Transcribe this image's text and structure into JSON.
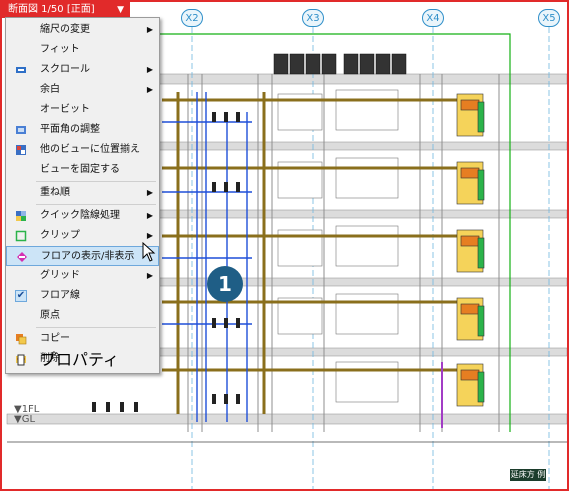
{
  "view_tab": {
    "label": "断面図 1/50 [正面]",
    "dropdown_icon": "triangle-down"
  },
  "grid_labels": [
    "X2",
    "X3",
    "X4",
    "X5"
  ],
  "levels": [
    "▼1FL",
    "▼GL"
  ],
  "scale_box": "延床方 例",
  "context_menu": {
    "items": [
      {
        "label": "縮尺の変更",
        "submenu": true
      },
      {
        "label": "フィット"
      },
      {
        "label": "スクロール",
        "submenu": true,
        "icon": "scroll-icon"
      },
      {
        "label": "余白",
        "submenu": true
      },
      {
        "label": "オービット"
      },
      {
        "label": "平面角の調整",
        "icon": "plane-angle-icon"
      },
      {
        "label": "他のビューに位置揃え",
        "icon": "align-view-icon"
      },
      {
        "label": "ビューを固定する"
      },
      {
        "label": "重ね順",
        "submenu": true
      },
      {
        "label": "クイック陰線処理",
        "submenu": true,
        "icon": "hidden-line-icon"
      },
      {
        "label": "クリップ",
        "submenu": true,
        "icon": "clip-icon"
      },
      {
        "label": "フロアの表示/非表示",
        "highlighted": true,
        "icon": "floor-visibility-icon"
      },
      {
        "label": "グリッド",
        "submenu": true
      },
      {
        "label": "フロア線",
        "checked": true
      },
      {
        "label": "原点"
      },
      {
        "label": "コピー",
        "icon": "copy-icon"
      },
      {
        "label": "削除",
        "icon": "delete-icon"
      },
      {
        "label": "プロパティ",
        "icon": "properties-icon"
      }
    ]
  },
  "callout": "1",
  "colors": {
    "frame": "#e12a2a",
    "highlight": "#cce4f7",
    "pipe_blue": "#1f4fd8",
    "duct_brown": "#8a6f1c",
    "grid_green": "#15b015",
    "equipment_orange": "#e67e22"
  }
}
